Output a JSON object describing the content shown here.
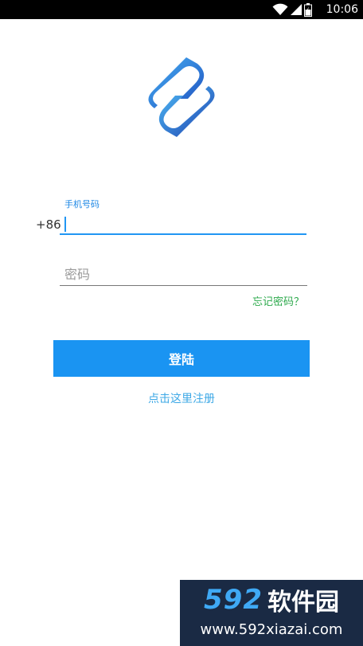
{
  "status_bar": {
    "time": "10:06",
    "icons": [
      "wifi-icon",
      "signal-icon",
      "battery-icon"
    ]
  },
  "logo": {
    "icon": "app-logo-icon",
    "colors": [
      "#1e4fbf",
      "#49b4f5"
    ]
  },
  "login_form": {
    "phone_label": "手机号码",
    "country_code": "+86",
    "phone_value": "",
    "password_placeholder": "密码",
    "password_value": "",
    "forgot_password": "忘记密码？",
    "login_button": "登陆",
    "register_link": "点击这里注册"
  },
  "watermark": {
    "digits": "592",
    "text": "软件园",
    "url": "www.592xiazai.com"
  },
  "colors": {
    "accent": "#1a94f2",
    "input_focus": "#2196f3",
    "forgot_link": "#2eaa4d",
    "register_link": "#3da8e6"
  }
}
